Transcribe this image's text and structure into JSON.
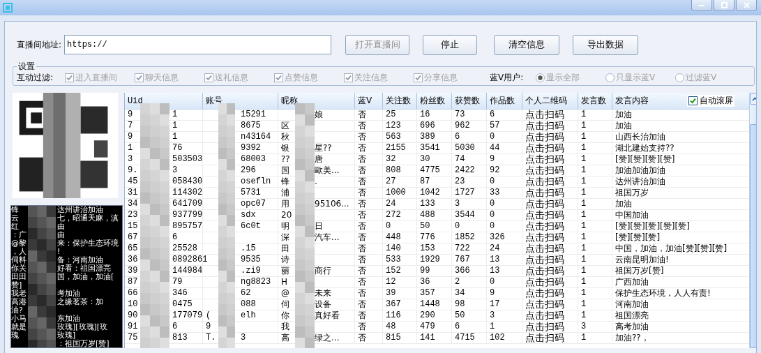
{
  "url_bar": {
    "label": "直播间地址:",
    "value": "https://"
  },
  "buttons": [
    {
      "label": "打开直播间",
      "disabled": true
    },
    {
      "label": "停止",
      "disabled": false
    },
    {
      "label": "清空信息",
      "disabled": false
    },
    {
      "label": "导出数据",
      "disabled": false
    }
  ],
  "settings": {
    "title": "设置",
    "filter_label": "互动过滤:",
    "filters": [
      {
        "label": "进入直播间",
        "checked": true,
        "disabled": true
      },
      {
        "label": "聊天信息",
        "checked": true,
        "disabled": true
      },
      {
        "label": "送礼信息",
        "checked": true,
        "disabled": true
      },
      {
        "label": "点赞信息",
        "checked": true,
        "disabled": true
      },
      {
        "label": "关注信息",
        "checked": true,
        "disabled": true
      },
      {
        "label": "分享信息",
        "checked": true,
        "disabled": true
      }
    ],
    "blue_v_label": "蓝V用户:",
    "blue_v_options": [
      {
        "label": "显示全部",
        "selected": true,
        "disabled": true
      },
      {
        "label": "只显示蓝V",
        "selected": false,
        "disabled": true
      },
      {
        "label": "过滤蓝V",
        "selected": false,
        "disabled": true
      }
    ]
  },
  "console": {
    "lines": [
      {
        "left": "锋",
        "right": "达州讲治加油"
      },
      {
        "left": "云",
        "right": "七，昭通天麻，滇"
      },
      {
        "left": "红",
        "right": "由"
      },
      {
        "left": "：广",
        "right": "由"
      },
      {
        "left": "@黎",
        "right": "来：保护生态环境"
      },
      {
        "left": "，人",
        "right": "!"
      },
      {
        "left": "伺料",
        "right": "备：河南加油"
      },
      {
        "left": "你关",
        "right": "好看：祖国漂亮"
      },
      {
        "left": "田田",
        "right": "国，加油，加油["
      },
      {
        "left": "赞]"
      },
      {
        "left": "我老",
        "right": "考加油"
      },
      {
        "left": "高港",
        "right": "之缘茗茶：加"
      },
      {
        "left": "油?"
      },
      {
        "left": "小马",
        "right": "东加油"
      },
      {
        "left": "就是",
        "right": "玫瑰][玫瑰][玫"
      },
      {
        "left": "瑰",
        "right": "玫瑰]"
      },
      {
        "right": "：祖国万岁[赞]"
      }
    ]
  },
  "table": {
    "columns": [
      "Uid",
      "账号",
      "昵称",
      "蓝V",
      "关注数",
      "粉丝数",
      "获赞数",
      "作品数",
      "个人二维码",
      "发言数",
      "发言内容"
    ],
    "auto_scroll": {
      "label": "自动滚屏",
      "checked": true
    },
    "rows": [
      {
        "uid_head": "9",
        "uid_tail": "1",
        "account_tail": "15291",
        "nickname_tail": "娘",
        "blue_v": "否",
        "follows": "25",
        "fans": "16",
        "likes": "73",
        "works": "6",
        "qr_code": "点击扫码",
        "message_count": "1",
        "message": "加油"
      },
      {
        "uid_head": "7",
        "uid_tail": "1",
        "account_tail": "8675",
        "nickname_head": "区",
        "blue_v": "否",
        "follows": "123",
        "fans": "696",
        "likes": "962",
        "works": "57",
        "qr_code": "点击扫码",
        "message_count": "1",
        "message": "加油"
      },
      {
        "uid_head": "9",
        "uid_tail": "1",
        "account_tail": "n43164",
        "nickname_head": "秋",
        "blue_v": "否",
        "follows": "563",
        "fans": "389",
        "likes": "6",
        "works": "0",
        "qr_code": "点击扫码",
        "message_count": "1",
        "message": "山西长治加油"
      },
      {
        "uid_head": "1",
        "uid_tail": "76",
        "account_tail": "9392",
        "nickname_head": "银",
        "nickname_tail": "星??",
        "blue_v": "否",
        "follows": "2155",
        "fans": "3541",
        "likes": "5030",
        "works": "44",
        "qr_code": "点击扫码",
        "message_count": "1",
        "message": "湖北建始支持??"
      },
      {
        "uid_head": "3",
        "uid_tail": "503503",
        "account_tail": "68003",
        "nickname_head": "??",
        "nickname_tail": "唐",
        "blue_v": "否",
        "follows": "32",
        "fans": "30",
        "likes": "74",
        "works": "9",
        "qr_code": "点击扫码",
        "message_count": "1",
        "message": "[赞][赞][赞][赞]"
      },
      {
        "uid_head": "9.",
        "uid_tail": "3",
        "account_tail": "296",
        "nickname_head": "国",
        "nickname_tail": "歐美...",
        "blue_v": "否",
        "follows": "808",
        "fans": "4775",
        "likes": "2422",
        "works": "92",
        "qr_code": "点击扫码",
        "message_count": "1",
        "message": "加油加油加油"
      },
      {
        "uid_head": "45",
        "uid_tail": "058430",
        "account_tail": "osefln",
        "nickname_head": "锋",
        "nickname_tail": ".",
        "blue_v": "否",
        "follows": "27",
        "fans": "87",
        "likes": "23",
        "works": "0",
        "qr_code": "点击扫码",
        "message_count": "1",
        "message": "达州讲治加油"
      },
      {
        "uid_head": "31",
        "uid_tail": "114302",
        "account_tail": "5731",
        "nickname_head": "浦",
        "blue_v": "否",
        "follows": "1000",
        "fans": "1042",
        "likes": "1727",
        "works": "33",
        "qr_code": "点击扫码",
        "message_count": "1",
        "message": "祖国万岁"
      },
      {
        "uid_head": "34",
        "uid_tail": "641709",
        "account_tail": "opc07",
        "nickname_head": "用",
        "nickname_tail": "95106...",
        "blue_v": "否",
        "follows": "24",
        "fans": "133",
        "likes": "3",
        "works": "0",
        "qr_code": "点击扫码",
        "message_count": "1",
        "message": "加油"
      },
      {
        "uid_head": "23",
        "uid_tail": "937799",
        "account_tail": "sdx",
        "nickname_head": "20",
        "blue_v": "否",
        "follows": "272",
        "fans": "488",
        "likes": "3544",
        "works": "0",
        "qr_code": "点击扫码",
        "message_count": "1",
        "message": "中国加油"
      },
      {
        "uid_head": "15",
        "uid_tail": "895757",
        "account_tail": "6c0t",
        "nickname_head": "明",
        "nickname_tail": "日",
        "blue_v": "否",
        "follows": "0",
        "fans": "50",
        "likes": "0",
        "works": "0",
        "qr_code": "点击扫码",
        "message_count": "1",
        "message": "[赞][赞][赞][赞][赞]"
      },
      {
        "uid_head": "67",
        "uid_tail": "6",
        "nickname_head": "深",
        "nickname_tail": "汽车...",
        "blue_v": "否",
        "follows": "448",
        "fans": "776",
        "likes": "1852",
        "works": "326",
        "qr_code": "点击扫码",
        "message_count": "1",
        "message": "[赞][赞][赞]"
      },
      {
        "uid_head": "65",
        "uid_tail": "25528",
        "account_tail": ".15",
        "nickname_head": "田",
        "blue_v": "否",
        "follows": "140",
        "fans": "153",
        "likes": "722",
        "works": "24",
        "qr_code": "点击扫码",
        "message_count": "1",
        "message": "中国，加油，加油[赞][赞][赞]"
      },
      {
        "uid_head": "36",
        "uid_tail": "0892861",
        "account_tail": "9535",
        "nickname_head": "诗",
        "blue_v": "否",
        "follows": "533",
        "fans": "1929",
        "likes": "767",
        "works": "13",
        "qr_code": "点击扫码",
        "message_count": "1",
        "message": "云南昆明加油!"
      },
      {
        "uid_head": "39",
        "uid_tail": "144984",
        "account_tail": ".zi9",
        "nickname_head": "丽",
        "nickname_tail": "商行",
        "blue_v": "否",
        "follows": "152",
        "fans": "99",
        "likes": "366",
        "works": "13",
        "qr_code": "点击扫码",
        "message_count": "1",
        "message": "祖国万岁[赞]"
      },
      {
        "uid_head": "87",
        "uid_tail": "79",
        "account_tail": "ng8823",
        "nickname_head": "H",
        "blue_v": "否",
        "follows": "12",
        "fans": "36",
        "likes": "2",
        "works": "0",
        "qr_code": "点击扫码",
        "message_count": "1",
        "message": "广西加油"
      },
      {
        "uid_head": "66",
        "uid_tail": "346",
        "account_tail": "62",
        "nickname_head": "@",
        "nickname_tail": "未来",
        "blue_v": "否",
        "follows": "39",
        "fans": "357",
        "likes": "34",
        "works": "9",
        "qr_code": "点击扫码",
        "message_count": "1",
        "message": "保护生态环境，人人有责!"
      },
      {
        "uid_head": "10",
        "uid_tail": "0475",
        "account_tail": "088",
        "nickname_head": "伺",
        "nickname_tail": "设备",
        "blue_v": "否",
        "follows": "367",
        "fans": "1448",
        "likes": "98",
        "works": "17",
        "qr_code": "点击扫码",
        "message_count": "1",
        "message": "河南加油"
      },
      {
        "uid_head": "90",
        "uid_tail": "177079",
        "account_head": "(",
        "account_tail": "elh",
        "nickname_head": "你",
        "nickname_tail": "真好看",
        "blue_v": "否",
        "follows": "116",
        "fans": "290",
        "likes": "50",
        "works": "3",
        "qr_code": "点击扫码",
        "message_count": "1",
        "message": "祖国漂亮"
      },
      {
        "uid_head": "91",
        "uid_tail": "6",
        "account_head": "9",
        "nickname_head": "我",
        "blue_v": "否",
        "follows": "48",
        "fans": "479",
        "likes": "6",
        "works": "1",
        "qr_code": "点击扫码",
        "message_count": "3",
        "message": "高考加油"
      },
      {
        "uid_head": "75",
        "uid_tail": "813",
        "account_head": "T.",
        "account_tail": "3",
        "nickname_head": "高",
        "nickname_tail": "绿之...",
        "blue_v": "否",
        "follows": "815",
        "fans": "141",
        "likes": "4715",
        "works": "102",
        "qr_code": "点击扫码",
        "message_count": "1",
        "message": "加油??，"
      }
    ]
  }
}
